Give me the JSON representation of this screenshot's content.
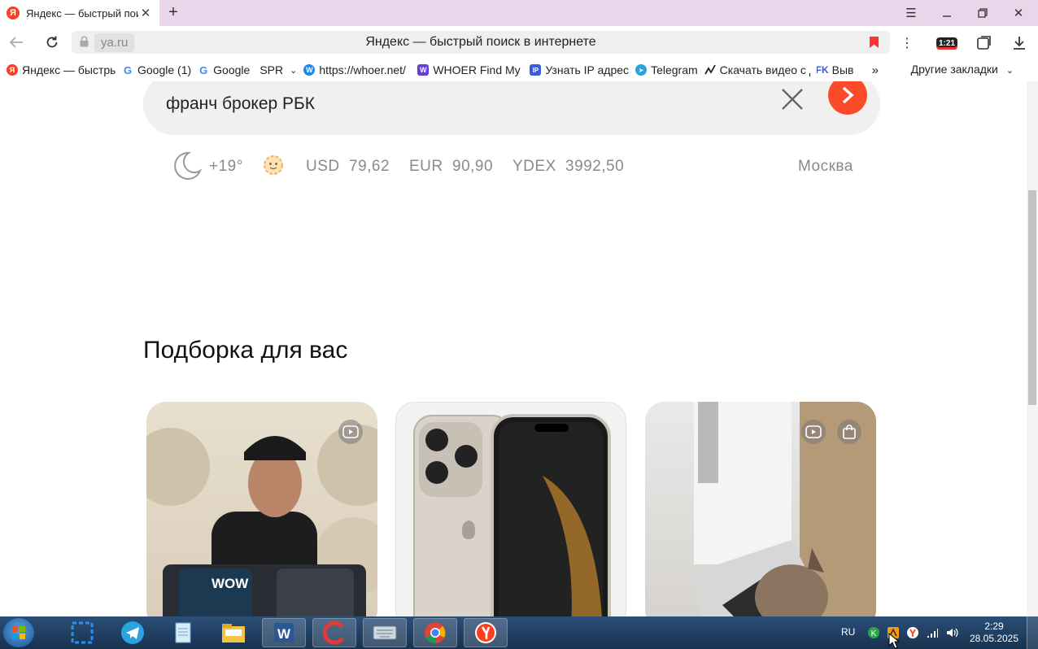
{
  "tab": {
    "title": "Яндекс — быстрый поиск в интернете",
    "favicon": "Я"
  },
  "address": {
    "host": "ya.ru",
    "page_title": "Яндекс — быстрый поиск в интернете",
    "clock_badge": "1:21"
  },
  "bookmarks": [
    {
      "label": "Яндекс — быстрый поиск в интернете",
      "icon": "yandex-icon",
      "color": "#fc3f1d"
    },
    {
      "label": "Google (1)",
      "icon": "google-icon",
      "color": "#4285f4"
    },
    {
      "label": "Google",
      "icon": "google-icon",
      "color": "#4285f4"
    },
    {
      "label": "SPR",
      "icon": "folder-icon",
      "color": "#ffffff"
    },
    {
      "label": "https://whoer.net/",
      "icon": "whoer-icon",
      "color": "#1e88e5"
    },
    {
      "label": "WHOER Find My IP",
      "icon": "whoer-icon",
      "color": "#6a3cd6"
    },
    {
      "label": "Узнать IP адрес",
      "icon": "ip-icon",
      "color": "#3b5bdb"
    },
    {
      "label": "Telegram",
      "icon": "telegram-icon",
      "color": "#2aa3e0"
    },
    {
      "label": "Скачать видео с Д",
      "icon": "chart-icon",
      "color": "#222222"
    },
    {
      "label": "Выв",
      "icon": "fk-icon",
      "color": "#3b5bdb"
    }
  ],
  "other_bookmarks": "Другие закладки",
  "search": {
    "query": "франч брокер РБК"
  },
  "info": {
    "temperature": "+19°",
    "usd_label": "USD",
    "usd_value": "79,62",
    "eur_label": "EUR",
    "eur_value": "90,90",
    "ydex_label": "YDEX",
    "ydex_value": "3992,50",
    "city": "Москва"
  },
  "feed": {
    "title": "Подборка для вас",
    "card1_overlay": "WOW"
  },
  "taskbar": {
    "lang": "RU",
    "time": "2:29",
    "date": "28.05.2025"
  },
  "colors": {
    "accent": "#fc4b2a",
    "tabstrip": "#e9d6ea",
    "taskbar": "#1f3f63"
  }
}
